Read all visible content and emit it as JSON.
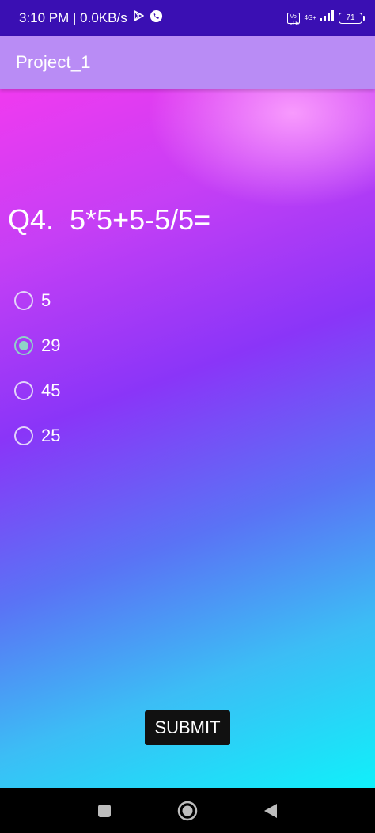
{
  "status_bar": {
    "time_speed": "3:10 PM | 0.0KB/s",
    "volte": "Vo LTE",
    "network": "4G+",
    "battery": "71"
  },
  "app_bar": {
    "title": "Project_1"
  },
  "quiz": {
    "question": "Q4.  5*5+5-5/5=",
    "options": [
      {
        "label": "5",
        "selected": false
      },
      {
        "label": "29",
        "selected": true
      },
      {
        "label": "45",
        "selected": false
      },
      {
        "label": "25",
        "selected": false
      }
    ],
    "submit_label": "SUBMIT"
  },
  "colors": {
    "status_bar": "#3a0fb3",
    "app_bar": "#b98cf5",
    "radio_selected": "#8fd3c7",
    "button": "#111111"
  }
}
